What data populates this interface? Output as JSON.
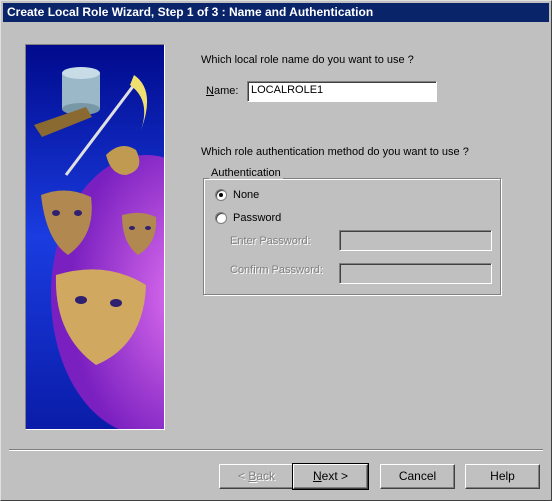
{
  "window": {
    "title": "Create Local Role Wizard, Step 1 of 3 : Name and Authentication"
  },
  "role_name": {
    "question": "Which local role name do you want to use ?",
    "label_prefix": "N",
    "label_rest": "ame:",
    "value": "LOCALROLE1"
  },
  "auth": {
    "question": "Which role authentication method do you want to use ?",
    "group_label": "Authentication",
    "options": [
      {
        "label": "None",
        "selected": true
      },
      {
        "label": "Password",
        "selected": false
      }
    ],
    "enter_password_label": "Enter Password:",
    "confirm_password_label": "Confirm Password:",
    "enter_password_value": "",
    "confirm_password_value": ""
  },
  "buttons": {
    "back_prefix": "< ",
    "back_key": "B",
    "back_rest": "ack",
    "next_key": "N",
    "next_rest": "ext >",
    "cancel": "Cancel",
    "help": "Help"
  },
  "colors": {
    "titlebar": "#0a246a",
    "face": "#c0c0c0"
  }
}
